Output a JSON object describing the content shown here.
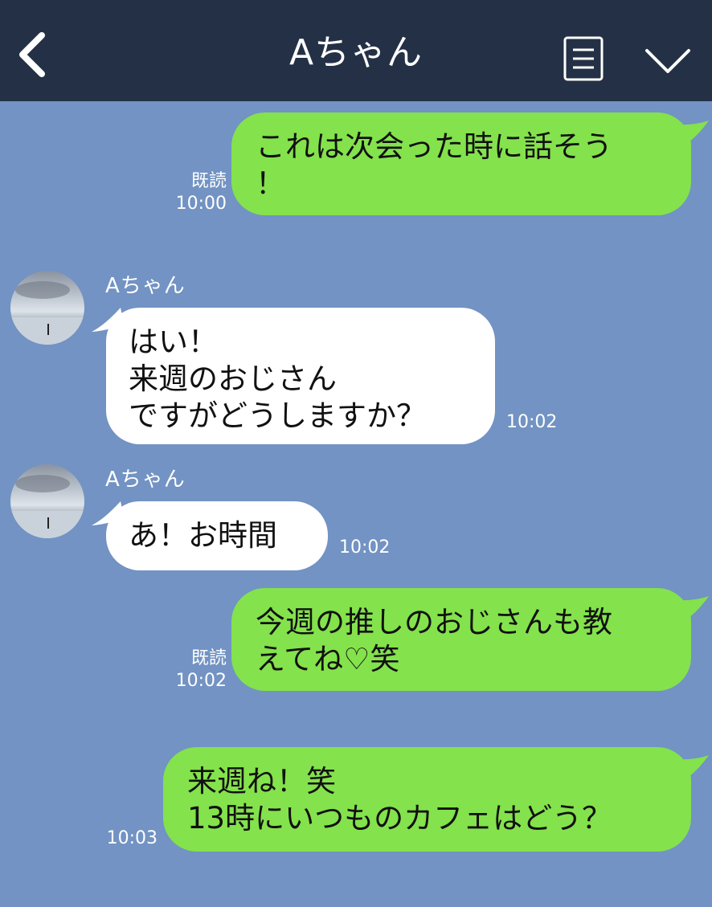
{
  "header": {
    "title": "Aちゃん",
    "back_icon": "chevron-left-icon",
    "menu_icon": "list-icon",
    "dropdown_icon": "chevron-down-icon"
  },
  "messages": [
    {
      "side": "out",
      "text": "これは次会った時に話そう\n！",
      "read": "既読",
      "time": "10:00"
    },
    {
      "side": "in",
      "sender": "Aちゃん",
      "text": "はい！\n来週のおじさん\nですがどうしますか？",
      "time": "10:02"
    },
    {
      "side": "in",
      "sender": "Aちゃん",
      "text": "あ！お時間",
      "time": "10:02"
    },
    {
      "side": "out",
      "text": "今週の推しのおじさんも教\nえてね♡笑",
      "read": "既読",
      "time": "10:02"
    },
    {
      "side": "out",
      "text": "来週ね！笑\n13時にいつものカフェはどう？",
      "read": "",
      "time": "10:03"
    }
  ],
  "colors": {
    "background": "#7293c3",
    "header": "#243045",
    "outgoing_bubble": "#84e24c",
    "incoming_bubble": "#ffffff"
  }
}
